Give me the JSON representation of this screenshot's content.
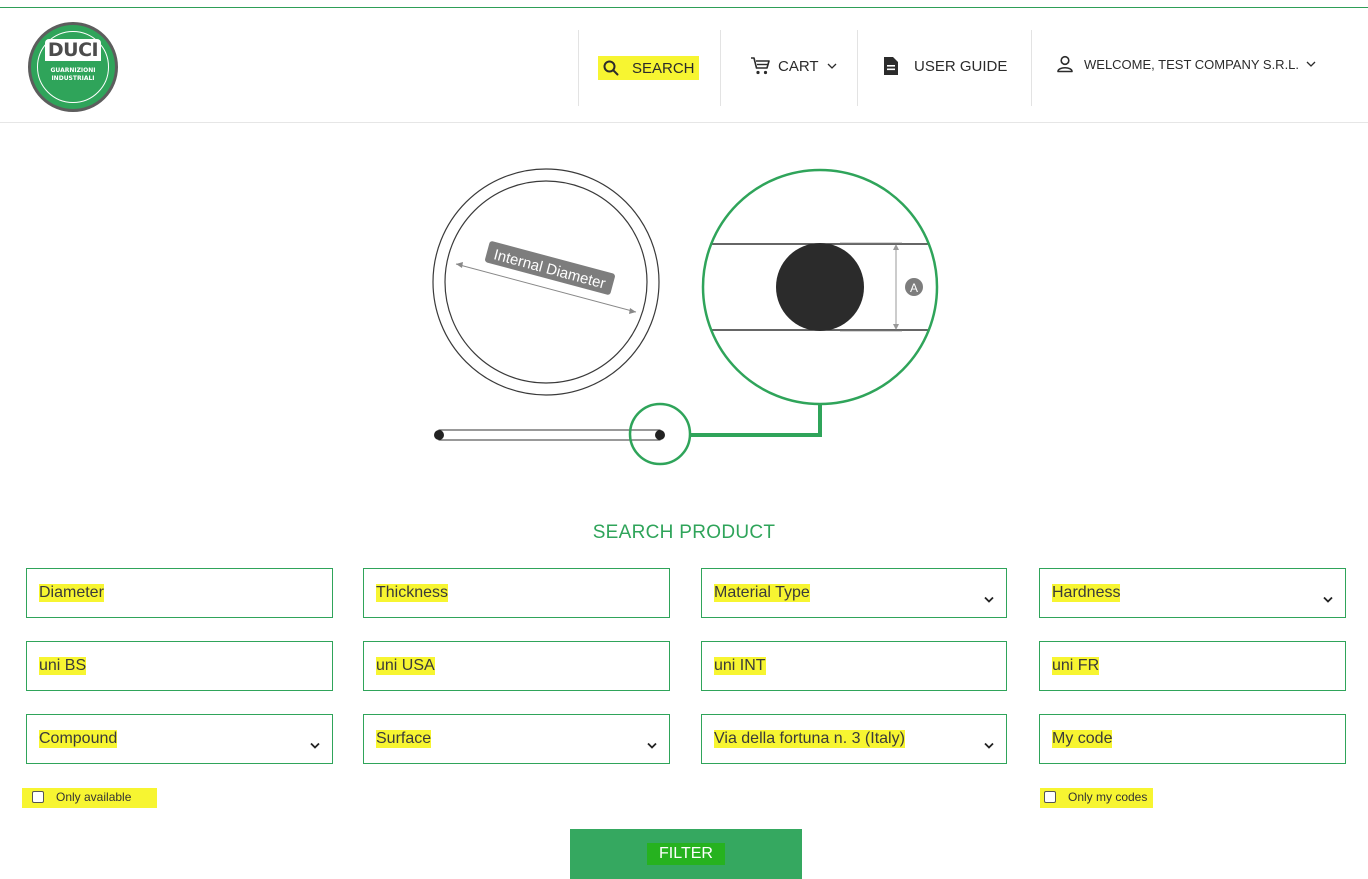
{
  "brand": {
    "logo_text": "DUCI",
    "logo_sub_1": "GUARNIZIONI",
    "logo_sub_2": "INDUSTRIALI",
    "green": "#2fa45a",
    "highlight": "#f7f531"
  },
  "nav": {
    "search": {
      "label": "SEARCH",
      "icon": "search-icon"
    },
    "cart": {
      "label": "CART",
      "icon": "cart-icon"
    },
    "guide": {
      "label": "USER GUIDE",
      "icon": "document-icon"
    },
    "account": {
      "label": "WELCOME, TEST COMPANY S.R.L.",
      "icon": "user-icon"
    }
  },
  "diagram": {
    "internal_diameter_label": "Internal Diameter",
    "thickness_marker": "A"
  },
  "search": {
    "title": "SEARCH PRODUCT",
    "fields": {
      "diameter": {
        "placeholder": "Diameter"
      },
      "thickness": {
        "placeholder": "Thickness"
      },
      "material_type": {
        "value": "Material Type"
      },
      "hardness": {
        "value": "Hardness"
      },
      "uni_bs": {
        "placeholder": "uni BS"
      },
      "uni_usa": {
        "placeholder": "uni USA"
      },
      "uni_int": {
        "placeholder": "uni INT"
      },
      "uni_fr": {
        "placeholder": "uni FR"
      },
      "compound": {
        "value": "Compound"
      },
      "surface": {
        "value": "Surface"
      },
      "location": {
        "value": "Via della fortuna n. 3 (Italy)"
      },
      "my_code": {
        "placeholder": "My code"
      }
    },
    "only_available": "Only available",
    "only_my_codes": "Only my codes",
    "filter_button": "FILTER"
  }
}
